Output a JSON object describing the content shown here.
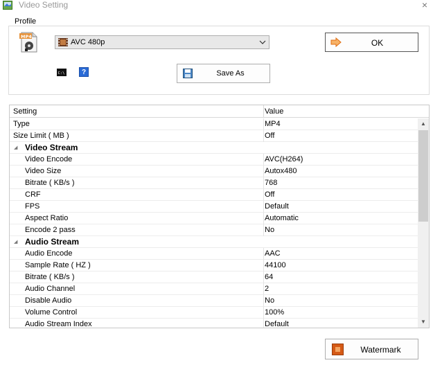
{
  "window": {
    "title": "Video Setting",
    "close_glyph": "×"
  },
  "profile_group": {
    "label": "Profile",
    "selected_profile": "AVC 480p",
    "icons": {
      "profile": "mp4-file-icon",
      "format": "film-icon",
      "command": "command-line-icon",
      "help": "help-icon"
    },
    "help_glyph": "?"
  },
  "buttons": {
    "ok": "OK",
    "save_as": "Save As",
    "watermark": "Watermark"
  },
  "grid": {
    "columns": [
      "Setting",
      "Value"
    ],
    "rows": [
      {
        "kind": "row",
        "setting": "Type",
        "value": "MP4"
      },
      {
        "kind": "row",
        "setting": "Size Limit ( MB )",
        "value": "Off"
      },
      {
        "kind": "category",
        "setting": "Video Stream",
        "value": ""
      },
      {
        "kind": "child",
        "setting": "Video Encode",
        "value": "AVC(H264)"
      },
      {
        "kind": "child",
        "setting": "Video Size",
        "value": "Autox480"
      },
      {
        "kind": "child",
        "setting": "Bitrate ( KB/s )",
        "value": "768"
      },
      {
        "kind": "child",
        "setting": "CRF",
        "value": "Off"
      },
      {
        "kind": "child",
        "setting": "FPS",
        "value": "Default"
      },
      {
        "kind": "child",
        "setting": "Aspect Ratio",
        "value": "Automatic"
      },
      {
        "kind": "child",
        "setting": "Encode 2 pass",
        "value": "No"
      },
      {
        "kind": "category",
        "setting": "Audio Stream",
        "value": ""
      },
      {
        "kind": "child",
        "setting": "Audio Encode",
        "value": "AAC"
      },
      {
        "kind": "child",
        "setting": "Sample Rate ( HZ )",
        "value": "44100"
      },
      {
        "kind": "child",
        "setting": "Bitrate ( KB/s )",
        "value": "64"
      },
      {
        "kind": "child",
        "setting": "Audio Channel",
        "value": "2"
      },
      {
        "kind": "child",
        "setting": "Disable Audio",
        "value": "No"
      },
      {
        "kind": "child",
        "setting": "Volume Control",
        "value": "100%"
      },
      {
        "kind": "child",
        "setting": "Audio Stream Index",
        "value": "Default"
      }
    ]
  },
  "colors": {
    "ok_arrow": "#f07d1e",
    "watermark_icon": "#d55a16",
    "help_icon": "#2a6bd6"
  }
}
